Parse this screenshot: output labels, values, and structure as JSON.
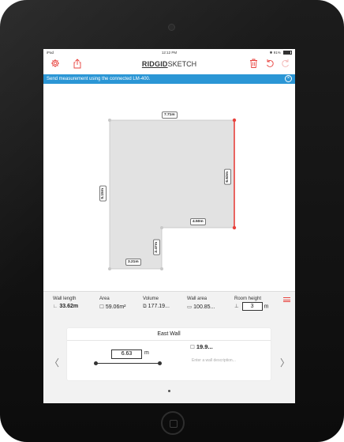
{
  "status_bar": {
    "device": "iPad",
    "time": "12:12 PM",
    "battery": "91%",
    "battery_level": 0.91
  },
  "toolbar": {
    "brand_bold": "RIDGID",
    "brand_rest": "SKETCH",
    "icons": [
      "gear-icon",
      "share-icon",
      "trash-icon",
      "undo-icon",
      "redo-icon"
    ]
  },
  "banner": {
    "text": "Send measurement using the connected LM-400."
  },
  "sketch": {
    "dims": {
      "top": "7.71m",
      "right": "6.63m",
      "left": "5.15m",
      "inner_horizontal": "4.50m",
      "inner_vertical": "2.47m",
      "bottom": "3.21m"
    }
  },
  "stats": {
    "wall_length": {
      "label": "Wall length",
      "value": "33.62m"
    },
    "area": {
      "label": "Area",
      "value": "59.06m²"
    },
    "volume": {
      "label": "Volume",
      "value": "177.19..."
    },
    "wall_area": {
      "label": "Wall area",
      "value": "100.85..."
    },
    "room_height": {
      "label": "Room height",
      "value": "3",
      "unit": "m"
    }
  },
  "wall_card": {
    "title": "East Wall",
    "length": "6.63",
    "unit": "m",
    "area": "19.9...",
    "description_placeholder": "Enter a wall description..."
  },
  "nav": {
    "prev": "〈",
    "next": "〉"
  },
  "colors": {
    "accent": "#e8413c",
    "banner": "#2b96d5",
    "room_fill": "#e2e2e2",
    "selected_wall": "#e8413c"
  }
}
